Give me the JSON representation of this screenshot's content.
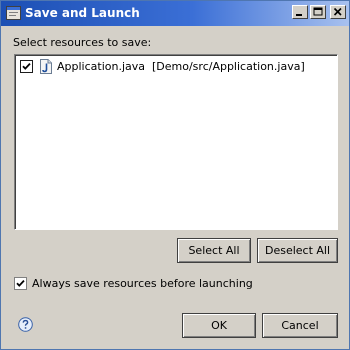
{
  "window": {
    "title": "Save and Launch",
    "title_bar_color": "#2a5bc4",
    "controls": {
      "minimize_icon": "minimize-icon",
      "maximize_icon": "maximize-icon",
      "close_icon": "close-icon"
    }
  },
  "resources": {
    "prompt": "Select resources to save:",
    "items": [
      {
        "checked": true,
        "icon": "java-file-icon",
        "label": "Application.java  [Demo/src/Application.java]"
      }
    ]
  },
  "selection_buttons": {
    "select_all": "Select All",
    "deselect_all": "Deselect All"
  },
  "options": {
    "always_save": {
      "label": "Always save resources before launching",
      "checked": true
    }
  },
  "footer": {
    "help_icon": "help-icon",
    "ok": "OK",
    "cancel": "Cancel"
  }
}
